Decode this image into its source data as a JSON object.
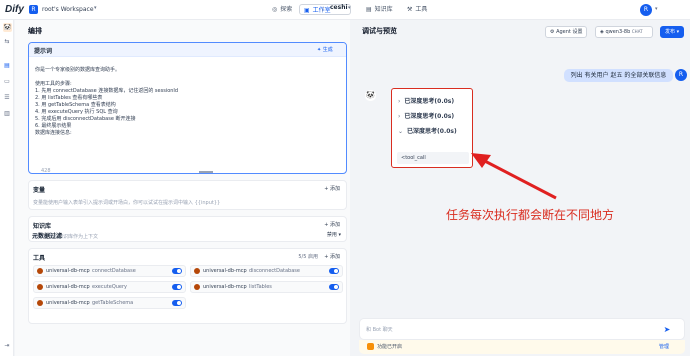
{
  "topbar": {
    "logo": "Dify",
    "workspace_initial": "R",
    "workspace_name": "root's Workspace",
    "nav_explore": "探索",
    "nav_studio": "工作室",
    "app_name": "ceshi",
    "nav_knowledge": "知识库",
    "nav_tools": "工具",
    "user_initial": "R"
  },
  "left": {
    "title": "编排",
    "prompt": {
      "label": "提示词",
      "generate": "生成",
      "text": "你是一个专家级别的数据库查询助手。\n\n使用工具的步骤:\n1. 先用 connectDatabase 连接数据库，记住返回的 sessionId\n2. 用 listTables 查看有哪些表\n3. 用 getTableSchema 查看表结构\n4. 用 executeQuery 执行 SQL 查询\n5. 完成后用 disconnectDatabase 断开连接\n6. 最终展示结果\n数据库连接信息:",
      "count": "428"
    },
    "variables": {
      "title": "变量",
      "add": "添加",
      "desc": "变量能使用户输入表单引入提示词或开场白，你可以试试在提示词中输入 {{input}}"
    },
    "knowledge": {
      "title": "知识库",
      "add": "添加",
      "desc": "您可以导入知识库作为上下文"
    },
    "metadata": {
      "title": "元数据过滤",
      "mode": "禁用"
    },
    "tools": {
      "title": "工具",
      "count": "5/5 启用",
      "add": "添加",
      "items": [
        {
          "provider": "universal-db-mcp",
          "name": "connectDatabase"
        },
        {
          "provider": "universal-db-mcp",
          "name": "disconnectDatabase"
        },
        {
          "provider": "universal-db-mcp",
          "name": "executeQuery"
        },
        {
          "provider": "universal-db-mcp",
          "name": "listTables"
        },
        {
          "provider": "universal-db-mcp",
          "name": "getTableSchema"
        }
      ]
    }
  },
  "right": {
    "title": "调试与预览",
    "agent_settings": "Agent 设置",
    "model": "qwen3-8b",
    "model_tag": "CHAT",
    "publish": "发布",
    "user_message": "列出 有关用户 赵五 的全部关联信息",
    "user_initial": "R",
    "thinking": [
      "已深度思考(0.0s)",
      "已深度思考(0.0s)",
      "已深度思考(0.0s)"
    ],
    "tool_call": "<tool_call",
    "annotation": "任务每次执行都会断在不同地方",
    "input_placeholder": "和 Bot 聊天",
    "feature_text": "功能已开启",
    "feature_manage": "管理"
  }
}
